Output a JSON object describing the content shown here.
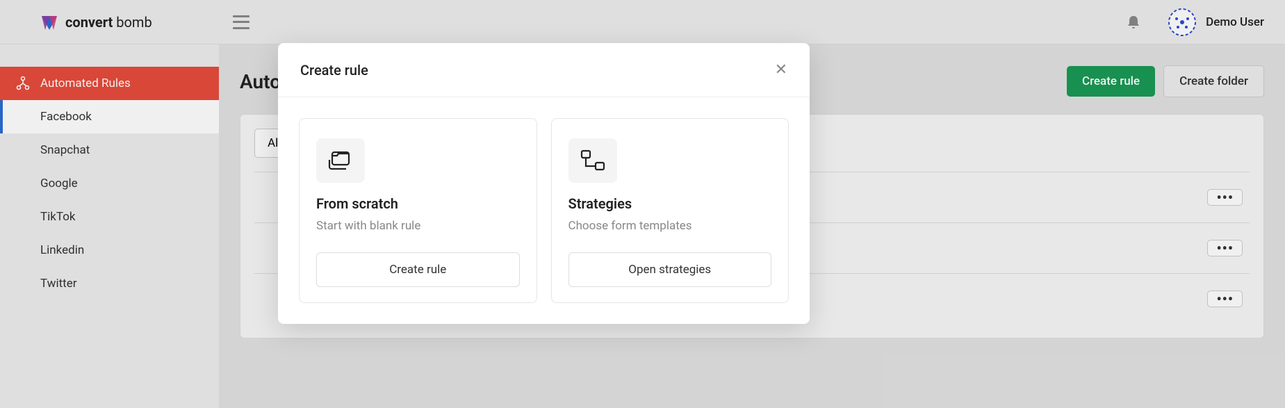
{
  "brand": {
    "bold": "convert",
    "light": " bomb"
  },
  "user": {
    "name": "Demo User"
  },
  "sidebar": {
    "main": "Automated Rules",
    "items": [
      "Facebook",
      "Snapchat",
      "Google",
      "TikTok",
      "Linkedin",
      "Twitter"
    ]
  },
  "page": {
    "title": "Auto",
    "create_rule_btn": "Create rule",
    "create_folder_btn": "Create folder",
    "filter_all": "All"
  },
  "modal": {
    "title": "Create rule",
    "cards": [
      {
        "title": "From scratch",
        "desc": "Start with blank rule",
        "btn": "Create rule"
      },
      {
        "title": "Strategies",
        "desc": "Choose form templates",
        "btn": "Open strategies"
      }
    ]
  }
}
